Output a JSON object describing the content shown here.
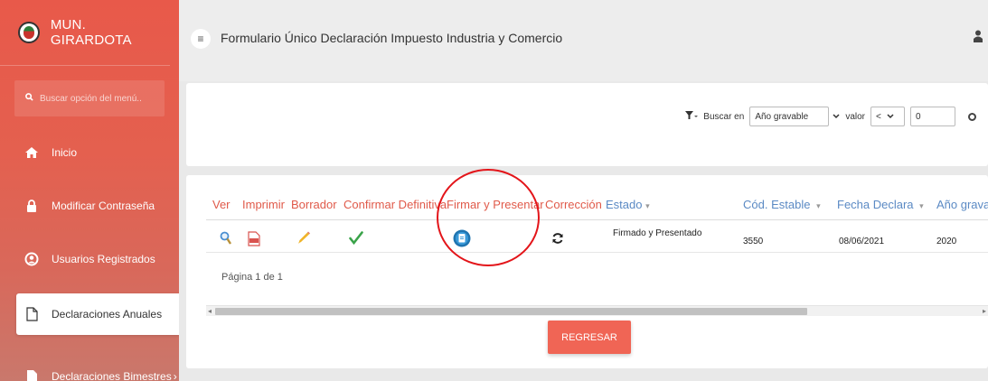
{
  "sidebar": {
    "title": "MUN. GIRARDOTA",
    "search_placeholder": "Buscar opción del menú..",
    "items": [
      {
        "label": "Inicio",
        "icon": "home-icon"
      },
      {
        "label": "Modificar Contraseña",
        "icon": "lock-icon"
      },
      {
        "label": "Usuarios Registrados",
        "icon": "user-circle-icon"
      },
      {
        "label": "Declaraciones Anuales",
        "icon": "file-outline-icon"
      },
      {
        "label": "Declaraciones Bimestres",
        "icon": "file-solid-icon"
      }
    ],
    "bimestres_arrow": "›"
  },
  "topbar": {
    "menu_icon": "≡",
    "title": "Formulario Único Declaración Impuesto Industria y Comercio"
  },
  "filter": {
    "search_in_label": "Buscar en",
    "field_value": "Año gravable",
    "value_label": "valor",
    "operator": "<",
    "number": "0"
  },
  "table": {
    "headers": [
      "Ver",
      "Imprimir",
      "Borrador",
      "Confirmar Definitiva",
      "Firmar y Presentar",
      "Corrección",
      "Estado",
      "Cód. Estable",
      "Fecha Declara",
      "Año gravable"
    ],
    "sort_marker": "▾",
    "row": {
      "estado": "Firmado y Presentado",
      "cod_estable": "3550",
      "fecha_declara": "08/06/2021",
      "anio_gravable": "2020"
    },
    "pager": "Página 1 de 1"
  },
  "back_button": "REGRESAR",
  "colors": {
    "accent": "#e05a4a",
    "sidebar_bg": "#e8594a",
    "button": "#f06555",
    "highlight_circle": "#e3151a"
  }
}
